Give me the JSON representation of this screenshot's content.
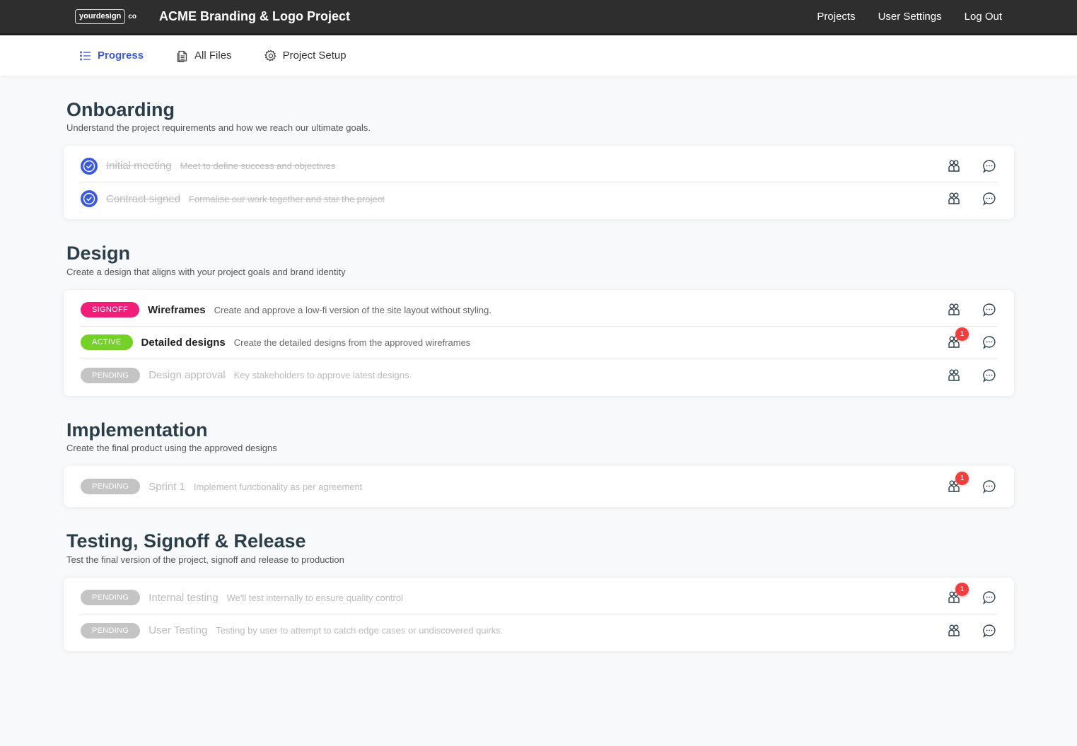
{
  "header": {
    "logo_text": "yourdesign",
    "logo_suffix": "co",
    "title": "ACME Branding & Logo Project",
    "nav": [
      {
        "label": "Projects"
      },
      {
        "label": "User Settings"
      },
      {
        "label": "Log Out"
      }
    ]
  },
  "subnav": {
    "tabs": [
      {
        "label": "Progress",
        "icon": "list-icon",
        "active": true
      },
      {
        "label": "All Files",
        "icon": "file-icon",
        "active": false
      },
      {
        "label": "Project Setup",
        "icon": "gear-icon",
        "active": false
      }
    ]
  },
  "colors": {
    "accent": "#3b5bdb",
    "signoff": "#f01e78",
    "active": "#74d126",
    "pending": "#c4c4c4",
    "notification": "#f03e3e"
  },
  "sections": [
    {
      "title": "Onboarding",
      "description": "Understand the project requirements and how we reach our ultimate goals.",
      "tasks": [
        {
          "status": "done",
          "name": "Initial meeting",
          "description": "Meet to define success and objectives",
          "notifications": null
        },
        {
          "status": "done",
          "name": "Contract signed",
          "description": "Formalise our work together and star the project",
          "notifications": null
        }
      ]
    },
    {
      "title": "Design",
      "description": "Create a design that aligns with your project goals and brand identity",
      "tasks": [
        {
          "status": "signoff",
          "badge": "SIGNOFF",
          "name": "Wireframes",
          "description": "Create and approve a low-fi version of the site layout without styling.",
          "notifications": null
        },
        {
          "status": "active",
          "badge": "ACTIVE",
          "name": "Detailed designs",
          "description": "Create the detailed designs from the approved wireframes",
          "notifications": "1"
        },
        {
          "status": "pending",
          "badge": "PENDING",
          "name": "Design approval",
          "description": "Key stakeholders to approve latest designs",
          "notifications": null
        }
      ]
    },
    {
      "title": "Implementation",
      "description": "Create the final product using the approved designs",
      "tasks": [
        {
          "status": "pending",
          "badge": "PENDING",
          "name": "Sprint 1",
          "description": "Implement functionality as per agreement",
          "notifications": "1"
        }
      ]
    },
    {
      "title": "Testing, Signoff & Release",
      "description": "Test the final version of the project, signoff and release to production",
      "tasks": [
        {
          "status": "pending",
          "badge": "PENDING",
          "name": "Internal testing",
          "description": "We'll test internally to ensure quality control",
          "notifications": "1"
        },
        {
          "status": "pending",
          "badge": "PENDING",
          "name": "User Testing",
          "description": "Testing by user to attempt to catch edge cases or undiscovered quirks.",
          "notifications": null
        }
      ]
    }
  ]
}
